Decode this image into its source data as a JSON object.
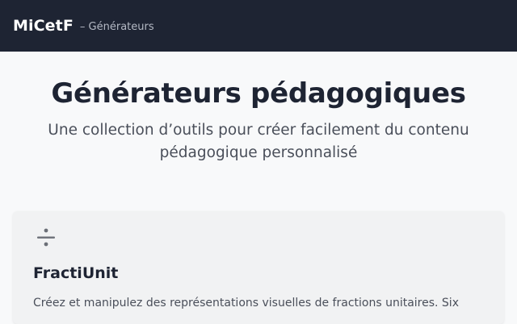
{
  "header": {
    "brand": "MiCetF",
    "section": "– Générateurs"
  },
  "hero": {
    "title": "Générateurs pédagogiques",
    "subtitle": "Une collection d’outils pour créer facilement du contenu pédagogique personnalisé"
  },
  "cards": [
    {
      "icon": "division-icon",
      "title": "FractiUnit",
      "description": "Créez et manipulez des représentations visuelles de fractions unitaires. Six"
    }
  ],
  "colors": {
    "header_bg": "#1e2433",
    "page_bg": "#f8f9fa",
    "title_text": "#1e2433",
    "body_text": "#4a4f5a"
  }
}
